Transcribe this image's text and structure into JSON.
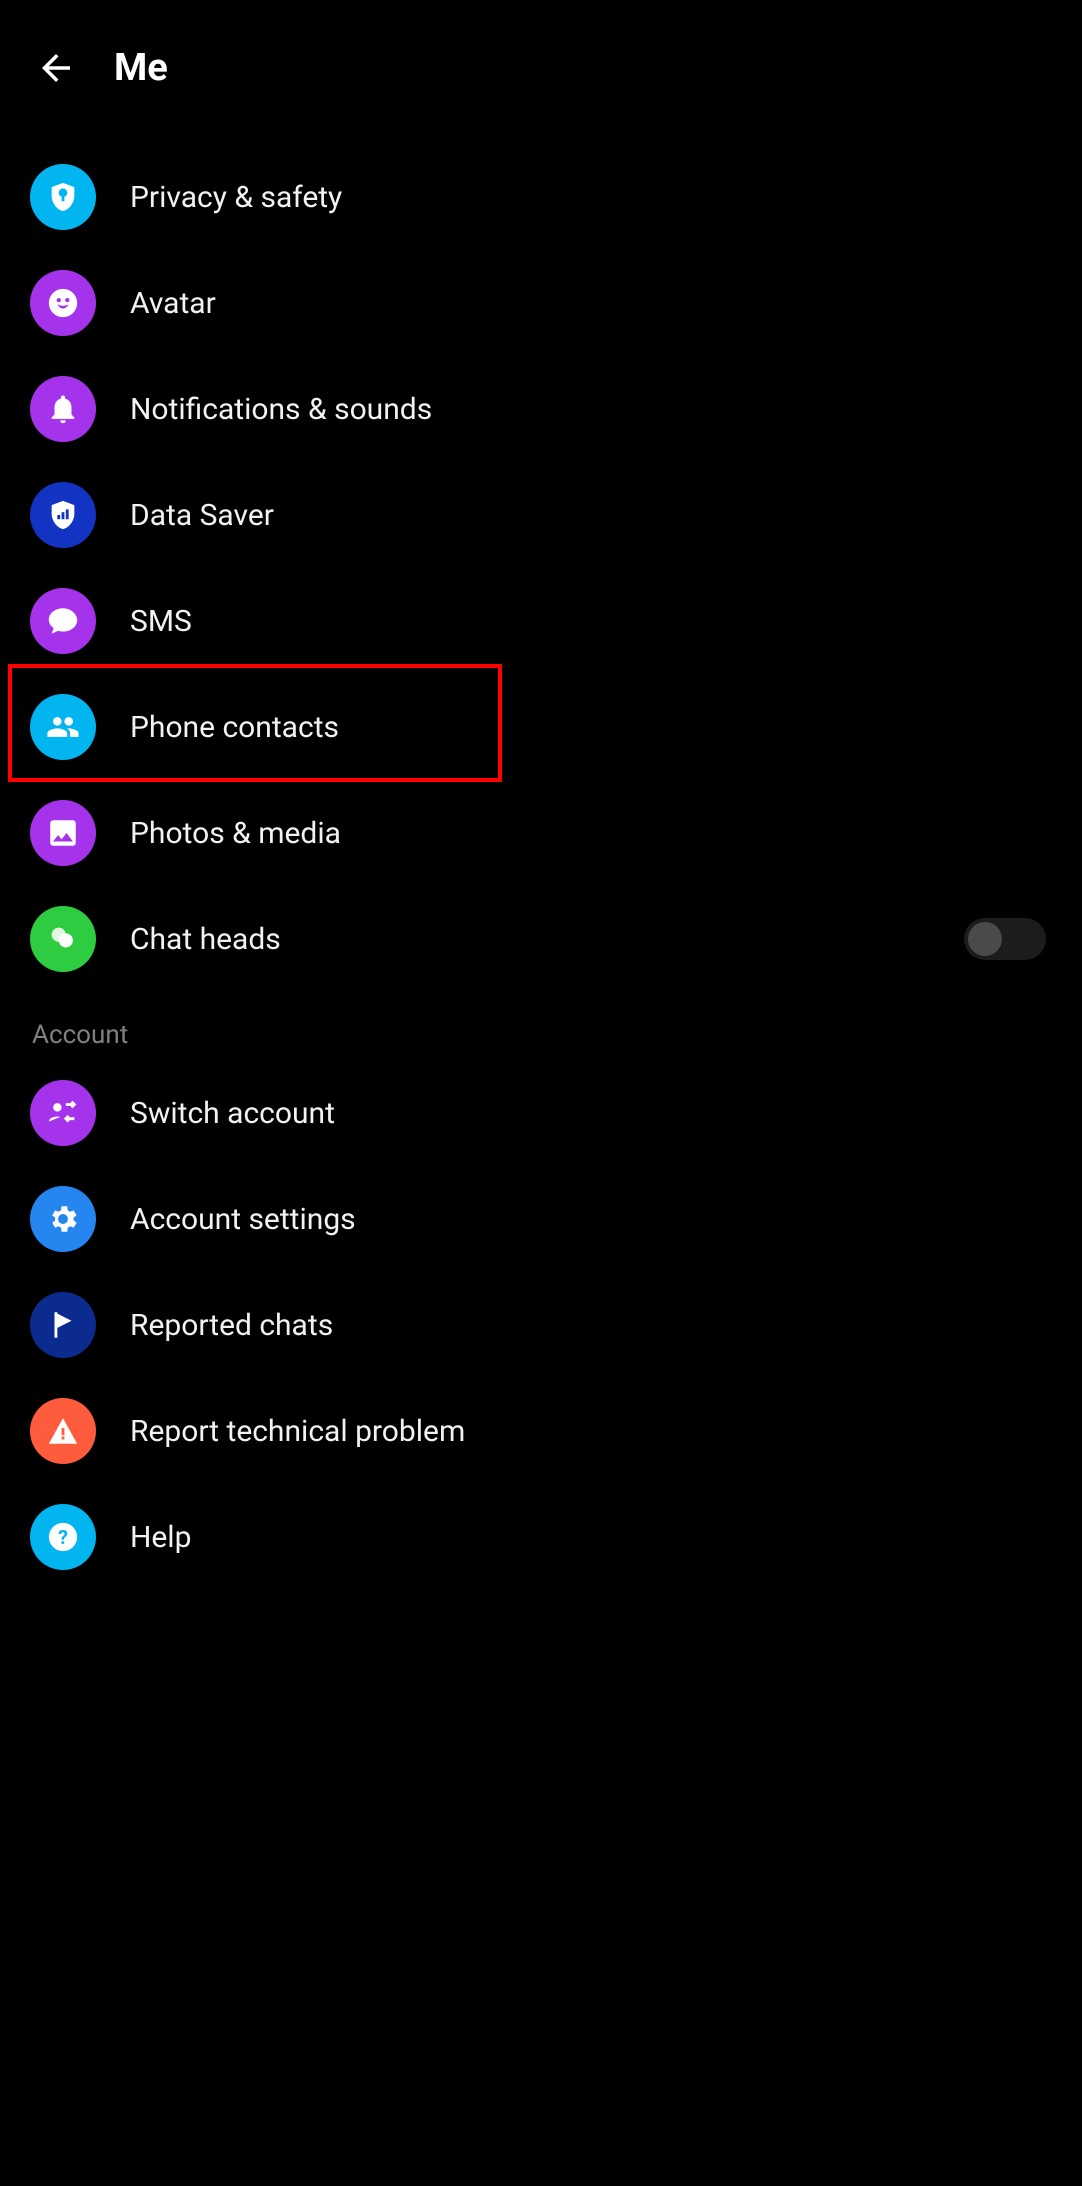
{
  "header": {
    "title": "Me"
  },
  "items": [
    {
      "label": "Privacy & safety"
    },
    {
      "label": "Avatar"
    },
    {
      "label": "Notifications & sounds"
    },
    {
      "label": "Data Saver"
    },
    {
      "label": "SMS"
    },
    {
      "label": "Phone contacts"
    },
    {
      "label": "Photos & media"
    },
    {
      "label": "Chat heads"
    }
  ],
  "section": {
    "account": "Account"
  },
  "account_items": [
    {
      "label": "Switch account"
    },
    {
      "label": "Account settings"
    },
    {
      "label": "Reported chats"
    },
    {
      "label": "Report technical problem"
    },
    {
      "label": "Help"
    }
  ],
  "toggle": {
    "chat_heads": false
  }
}
